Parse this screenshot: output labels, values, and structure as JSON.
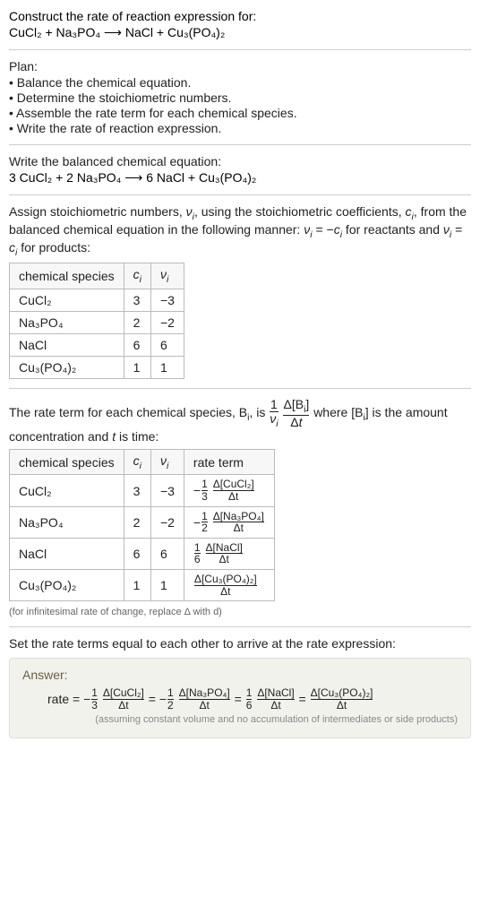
{
  "header": {
    "prompt": "Construct the rate of reaction expression for:",
    "equation": "CuCl₂ + Na₃PO₄ ⟶ NaCl + Cu₃(PO₄)₂"
  },
  "plan": {
    "title": "Plan:",
    "items": [
      "• Balance the chemical equation.",
      "• Determine the stoichiometric numbers.",
      "• Assemble the rate term for each chemical species.",
      "• Write the rate of reaction expression."
    ]
  },
  "balanced": {
    "intro": "Write the balanced chemical equation:",
    "equation": "3 CuCl₂ + 2 Na₃PO₄ ⟶ 6 NaCl + Cu₃(PO₄)₂"
  },
  "assign": {
    "intro_html": "Assign stoichiometric numbers, <i>ν<sub>i</sub></i>, using the stoichiometric coefficients, <i>c<sub>i</sub></i>, from the balanced chemical equation in the following manner: <i>ν<sub>i</sub></i> = −<i>c<sub>i</sub></i> for reactants and <i>ν<sub>i</sub></i> = <i>c<sub>i</sub></i> for products:",
    "headers": [
      "chemical species",
      "cᵢ",
      "νᵢ"
    ],
    "rows": [
      [
        "CuCl₂",
        "3",
        "−3"
      ],
      [
        "Na₃PO₄",
        "2",
        "−2"
      ],
      [
        "NaCl",
        "6",
        "6"
      ],
      [
        "Cu₃(PO₄)₂",
        "1",
        "1"
      ]
    ]
  },
  "rateterm": {
    "intro_pre": "The rate term for each chemical species, B",
    "intro_post1": ", is ",
    "intro_post2": " where [B",
    "intro_post3": "] is the amount concentration and ",
    "intro_post4": " is time:",
    "frac1_num": "1",
    "frac1_den": "νᵢ",
    "frac2_num": "Δ[Bᵢ]",
    "frac2_den": "Δt",
    "t_var": "t",
    "headers": [
      "chemical species",
      "cᵢ",
      "νᵢ",
      "rate term"
    ],
    "rows": [
      {
        "sp": "CuCl₂",
        "c": "3",
        "v": "−3",
        "sign": "−",
        "coef_num": "1",
        "coef_den": "3",
        "d_num": "Δ[CuCl₂]",
        "d_den": "Δt"
      },
      {
        "sp": "Na₃PO₄",
        "c": "2",
        "v": "−2",
        "sign": "−",
        "coef_num": "1",
        "coef_den": "2",
        "d_num": "Δ[Na₃PO₄]",
        "d_den": "Δt"
      },
      {
        "sp": "NaCl",
        "c": "6",
        "v": "6",
        "sign": "",
        "coef_num": "1",
        "coef_den": "6",
        "d_num": "Δ[NaCl]",
        "d_den": "Δt"
      },
      {
        "sp": "Cu₃(PO₄)₂",
        "c": "1",
        "v": "1",
        "sign": "",
        "coef_num": "",
        "coef_den": "",
        "d_num": "Δ[Cu₃(PO₄)₂]",
        "d_den": "Δt"
      }
    ],
    "note": "(for infinitesimal rate of change, replace Δ with d)"
  },
  "final": {
    "intro": "Set the rate terms equal to each other to arrive at the rate expression:"
  },
  "answer": {
    "title": "Answer:",
    "lead": "rate = ",
    "terms": [
      {
        "sign": "−",
        "coef_num": "1",
        "coef_den": "3",
        "d_num": "Δ[CuCl₂]",
        "d_den": "Δt"
      },
      {
        "sign": "−",
        "coef_num": "1",
        "coef_den": "2",
        "d_num": "Δ[Na₃PO₄]",
        "d_den": "Δt"
      },
      {
        "sign": "",
        "coef_num": "1",
        "coef_den": "6",
        "d_num": "Δ[NaCl]",
        "d_den": "Δt"
      },
      {
        "sign": "",
        "coef_num": "",
        "coef_den": "",
        "d_num": "Δ[Cu₃(PO₄)₂]",
        "d_den": "Δt"
      }
    ],
    "eq": " = ",
    "assumption": "(assuming constant volume and no accumulation of intermediates or side products)"
  }
}
